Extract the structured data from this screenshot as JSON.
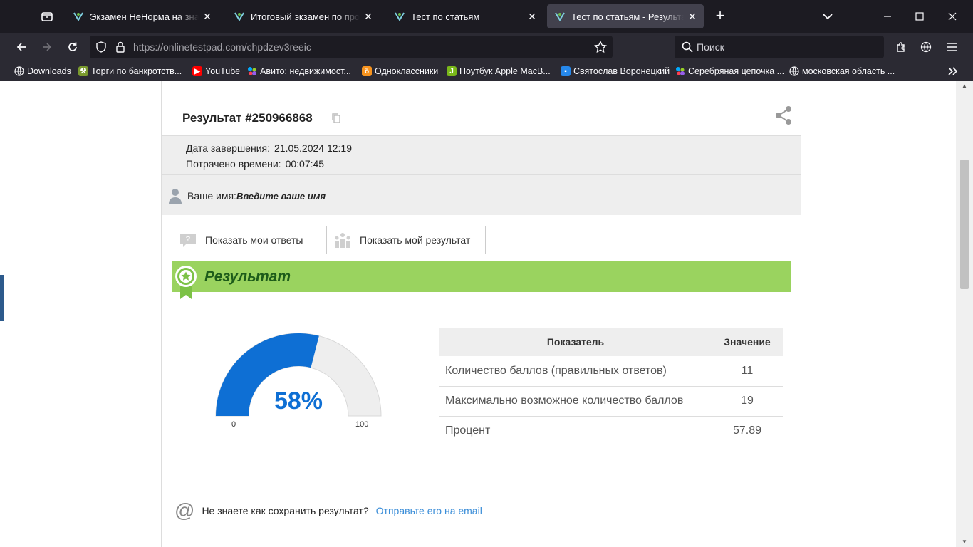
{
  "tabs": [
    {
      "title": "Экзамен НеНорма на знание пр",
      "active": false
    },
    {
      "title": "Итоговый экзамен по програм",
      "active": false
    },
    {
      "title": "Тест по статьям",
      "active": false
    },
    {
      "title": "Тест по статьям - Результат он",
      "active": true
    }
  ],
  "navbar": {
    "url_host": "https://onlinetestpad.com/",
    "url_path": "chpdzev3reeic",
    "search_placeholder": "Поиск"
  },
  "bookmarks": [
    {
      "label": "Downloads",
      "icon": "globe-icon",
      "color": "#2b2a33"
    },
    {
      "label": "Торги по банкротств...",
      "icon": "hammer-icon",
      "color": "#7a9a2e"
    },
    {
      "label": "YouTube",
      "icon": "youtube-icon",
      "color": "#ff0000"
    },
    {
      "label": "Авито: недвижимост...",
      "icon": "avito-icon",
      "color": "#00aaff"
    },
    {
      "label": "Одноклассники",
      "icon": "ok-icon",
      "color": "#f7931e"
    },
    {
      "label": "Ноутбук Apple MacB...",
      "icon": "market-icon",
      "color": "#7ab81a"
    },
    {
      "label": "Святослав Воронецкий",
      "icon": "chat-icon",
      "color": "#2688eb"
    },
    {
      "label": "Серебряная цепочка ...",
      "icon": "avito-icon",
      "color": "#97cf26"
    },
    {
      "label": "московская область ...",
      "icon": "globe-icon",
      "color": "#2b2a33"
    }
  ],
  "result": {
    "title": "Результат #250966868",
    "finish_label": "Дата завершения:",
    "finish_value": "21.05.2024 12:19",
    "time_label": "Потрачено времени:",
    "time_value": "00:07:45",
    "name_label": "Ваше имя:",
    "name_value": "Введите ваше имя"
  },
  "buttons": {
    "show_answers": "Показать мои ответы",
    "show_result": "Показать мой результат"
  },
  "banner": {
    "title": "Результат"
  },
  "gauge": {
    "percent_label": "58%",
    "fraction": 0.58,
    "min_label": "0",
    "max_label": "100"
  },
  "stats": {
    "headers": [
      "Показатель",
      "Значение"
    ],
    "rows": [
      [
        "Количество баллов (правильных ответов)",
        "11"
      ],
      [
        "Максимально возможное количество баллов",
        "19"
      ],
      [
        "Процент",
        "57.89"
      ]
    ]
  },
  "email": {
    "question": "Не знаете как сохранить результат?",
    "link": "Отправьте его на email"
  },
  "colors": {
    "gauge_fill": "#0e6fd4",
    "gauge_empty": "#eeeeee",
    "banner": "#9ad35f",
    "banner_text": "#1d5c1a",
    "link": "#3a8dd8"
  }
}
